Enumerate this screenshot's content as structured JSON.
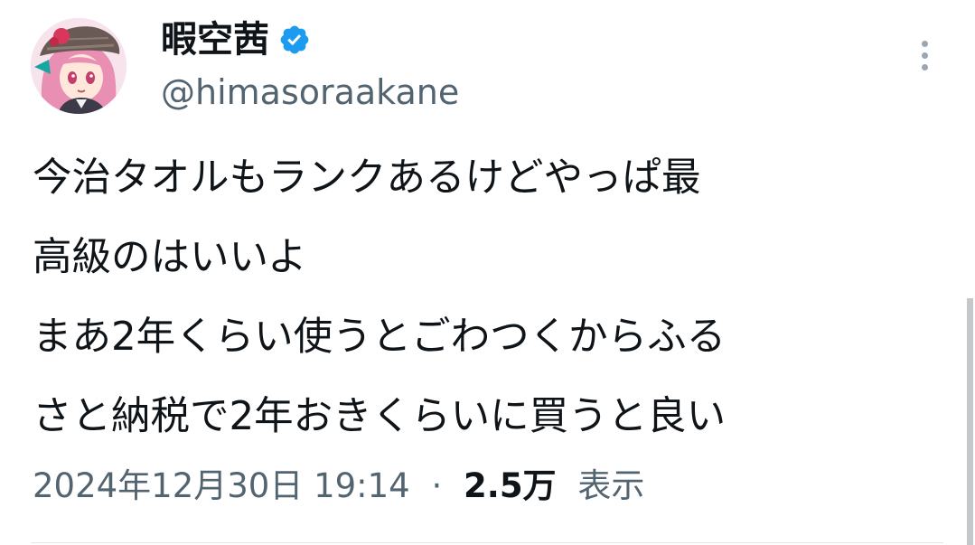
{
  "user": {
    "display_name": "暇空茜",
    "handle": "@himasoraakane",
    "verified": true,
    "avatar_icon": "avatar-image"
  },
  "tweet": {
    "lines": [
      "今治タオルもランクあるけどやっぱ最",
      "高級のはいいよ",
      "まあ2年くらい使うとごわつくからふる",
      "さと納税で2年おきくらいに買うと良い"
    ]
  },
  "meta": {
    "timestamp": "2024年12月30日 19:14",
    "separator": "·",
    "views_count": "2.5万",
    "views_label": "表示"
  },
  "icons": {
    "verified": "verified-badge-icon",
    "more": "more-options-icon"
  },
  "colors": {
    "text_primary": "#0f1419",
    "text_secondary": "#536471",
    "verified_blue": "#1d9bf0"
  }
}
